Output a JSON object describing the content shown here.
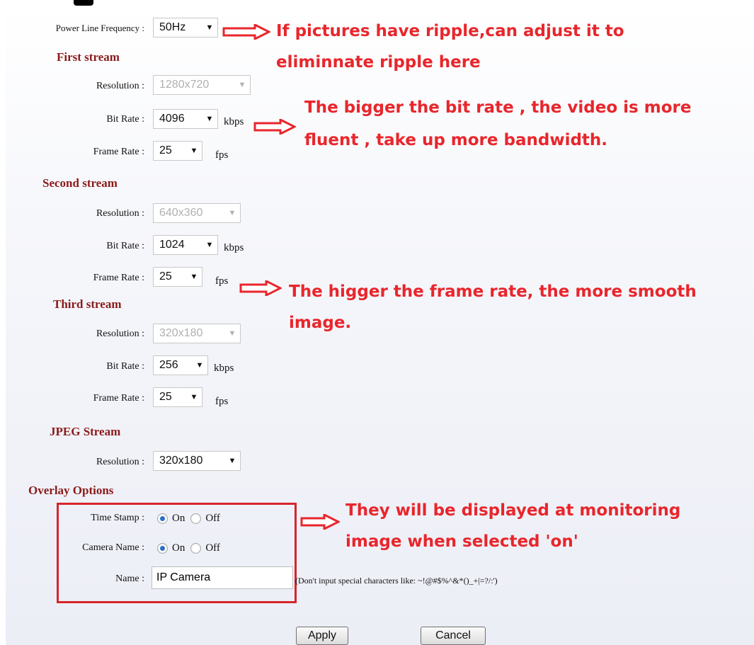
{
  "power_line": {
    "label": "Power Line Frequency :",
    "value": "50Hz"
  },
  "first_stream": {
    "title": "First stream",
    "resolution": {
      "label": "Resolution :",
      "value": "1280x720"
    },
    "bit_rate": {
      "label": "Bit Rate :",
      "value": "4096",
      "unit": "kbps"
    },
    "frame_rate": {
      "label": "Frame Rate :",
      "value": "25",
      "unit": "fps"
    }
  },
  "second_stream": {
    "title": "Second stream",
    "resolution": {
      "label": "Resolution :",
      "value": "640x360"
    },
    "bit_rate": {
      "label": "Bit Rate :",
      "value": "1024",
      "unit": "kbps"
    },
    "frame_rate": {
      "label": "Frame Rate :",
      "value": "25",
      "unit": "fps"
    }
  },
  "third_stream": {
    "title": "Third stream",
    "resolution": {
      "label": "Resolution :",
      "value": "320x180"
    },
    "bit_rate": {
      "label": "Bit Rate :",
      "value": "256",
      "unit": "kbps"
    },
    "frame_rate": {
      "label": "Frame Rate :",
      "value": "25",
      "unit": "fps"
    }
  },
  "jpeg_stream": {
    "title": "JPEG Stream",
    "resolution": {
      "label": "Resolution :",
      "value": "320x180"
    }
  },
  "overlay": {
    "title": "Overlay Options",
    "time_stamp": {
      "label": "Time Stamp :",
      "on": "On",
      "off": "Off",
      "selected": "On"
    },
    "camera_name": {
      "label": "Camera Name :",
      "on": "On",
      "off": "Off",
      "selected": "On"
    },
    "name": {
      "label": "Name :",
      "value": "IP Camera",
      "hint": "(Don't input special characters like: ~!@#$%^&*()_+|=?/:')"
    }
  },
  "buttons": {
    "apply": "Apply",
    "cancel": "Cancel"
  },
  "annotations": {
    "ripple_line1": "If pictures have ripple,can adjust it to",
    "ripple_line2": "eliminnate ripple here",
    "bitrate_line1": "The bigger the bit rate , the video is more",
    "bitrate_line2": "fluent , take up more bandwidth.",
    "framerate_line1": "The higger the frame rate, the more smooth",
    "framerate_line2": "image.",
    "overlay_line1": "They will be displayed at monitoring",
    "overlay_line2": "image when selected 'on'"
  },
  "colors": {
    "annotation": "#e8262c",
    "section_title": "#8b1a1a",
    "radio_on": "#2e6fc5"
  },
  "icons": {
    "dropdown": "chevron-down-icon",
    "pointer": "arrow-right-icon"
  }
}
